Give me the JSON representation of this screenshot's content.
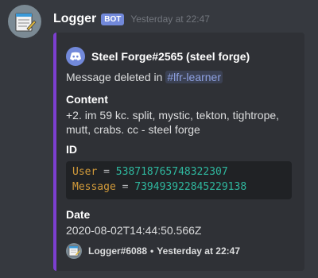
{
  "message": {
    "username": "Logger",
    "bot_tag": "BOT",
    "timestamp": "Yesterday at 22:47"
  },
  "embed": {
    "accent_color": "#7c3fd0",
    "author": {
      "icon": "discord-logo-icon",
      "name": "Steel Forge#2565 (steel forge)"
    },
    "description_prefix": "Message deleted in",
    "channel_mention": "#lfr-learner",
    "fields": {
      "content": {
        "name": "Content",
        "value": "+2. im 59 kc. split, mystic, tekton, tightrope, mutt, crabs. cc - steel forge"
      },
      "id": {
        "name": "ID",
        "code": [
          {
            "key": "User",
            "eq": "=",
            "value": "538718765748322307"
          },
          {
            "key": "Message",
            "eq": "=",
            "value": "739493922845229138"
          }
        ]
      },
      "date": {
        "name": "Date",
        "value": "2020-08-02T14:44:50.566Z"
      }
    },
    "footer": {
      "text": "Logger#6088",
      "separator": "•",
      "timestamp": "Yesterday at 22:47"
    }
  },
  "colors": {
    "background": "#36393f",
    "embed_bg": "#2f3136",
    "bot_tag": "#7289da",
    "code_key": "#d19a3a",
    "code_value": "#2fb89f"
  }
}
